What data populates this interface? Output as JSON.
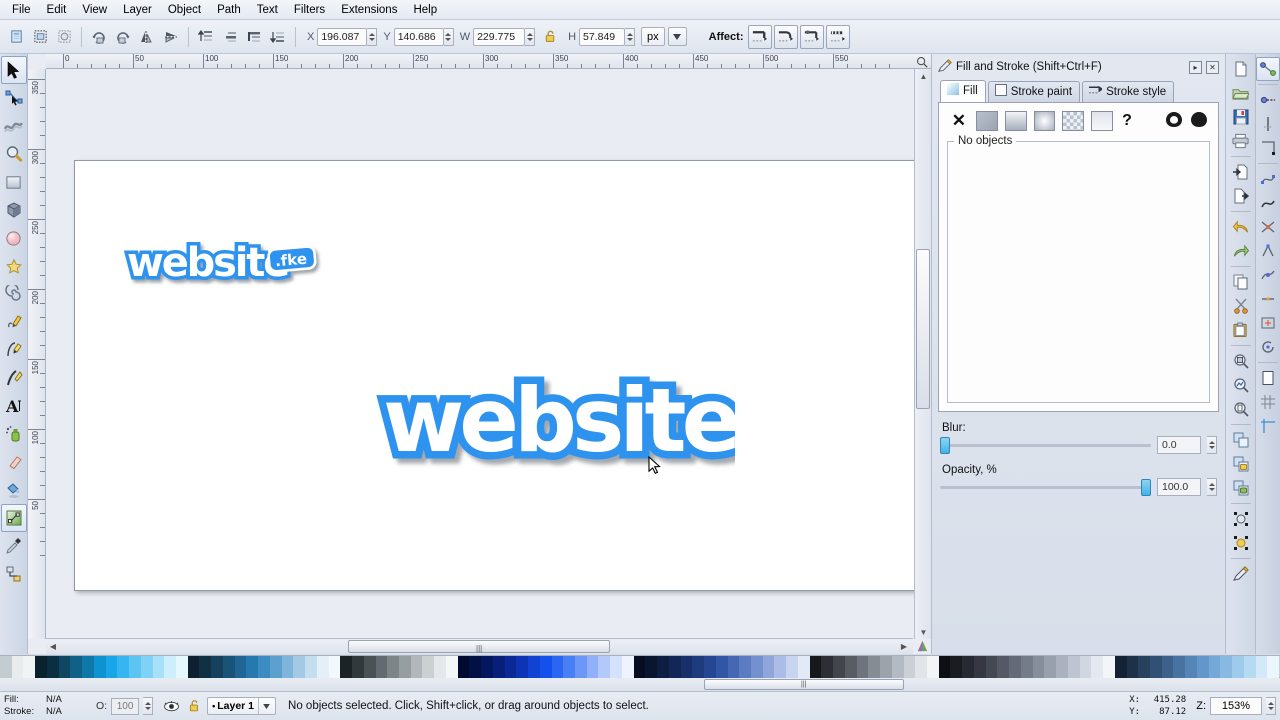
{
  "app": {
    "title": "Inkscape"
  },
  "menubar": {
    "items": [
      {
        "label": "File"
      },
      {
        "label": "Edit"
      },
      {
        "label": "View"
      },
      {
        "label": "Layer"
      },
      {
        "label": "Object"
      },
      {
        "label": "Path"
      },
      {
        "label": "Text"
      },
      {
        "label": "Filters"
      },
      {
        "label": "Extensions"
      },
      {
        "label": "Help"
      }
    ]
  },
  "commandbar": {
    "buttons": [
      {
        "name": "select-all-icon"
      },
      {
        "name": "select-all-in-all-layers-icon"
      },
      {
        "name": "deselect-icon"
      },
      {
        "name": "rotate-90-ccw-icon"
      },
      {
        "name": "rotate-90-cw-icon"
      },
      {
        "name": "flip-horizontal-icon"
      },
      {
        "name": "flip-vertical-icon"
      },
      {
        "name": "raise-to-top-icon"
      },
      {
        "name": "raise-icon"
      },
      {
        "name": "lower-icon"
      },
      {
        "name": "lower-to-bottom-icon"
      }
    ],
    "x_label": "X",
    "x_value": "196.087",
    "y_label": "Y",
    "y_value": "140.686",
    "w_label": "W",
    "w_value": "229.775",
    "h_label": "H",
    "h_value": "57.849",
    "lock_state": "unlocked",
    "unit_value": "px",
    "affect_label": "Affect:"
  },
  "toolbox": {
    "tools": [
      {
        "name": "selector-tool",
        "label": "Selector",
        "active": true
      },
      {
        "name": "node-tool",
        "label": "Node editor",
        "active": false
      },
      {
        "name": "tweak-tool",
        "label": "Tweak",
        "active": false
      },
      {
        "name": "zoom-tool",
        "label": "Zoom",
        "active": false
      },
      {
        "name": "rectangle-tool",
        "label": "Rectangle",
        "active": false
      },
      {
        "name": "3dbox-tool",
        "label": "3D Box",
        "active": false
      },
      {
        "name": "ellipse-tool",
        "label": "Ellipse",
        "active": false
      },
      {
        "name": "star-tool",
        "label": "Star",
        "active": false
      },
      {
        "name": "spiral-tool",
        "label": "Spiral",
        "active": false
      },
      {
        "name": "pencil-tool",
        "label": "Pencil",
        "active": false
      },
      {
        "name": "bezier-tool",
        "label": "Bezier/Pen",
        "active": false
      },
      {
        "name": "calligraphy-tool",
        "label": "Calligraphy",
        "active": false
      },
      {
        "name": "text-tool",
        "label": "Text",
        "active": false
      },
      {
        "name": "spray-tool",
        "label": "Spray",
        "active": false
      },
      {
        "name": "eraser-tool",
        "label": "Eraser",
        "active": false
      },
      {
        "name": "bucket-fill-tool",
        "label": "Bucket fill",
        "active": false
      },
      {
        "name": "gradient-tool",
        "label": "Gradient",
        "active": true
      },
      {
        "name": "dropper-tool",
        "label": "Dropper",
        "active": false
      },
      {
        "name": "connector-tool",
        "label": "Connector",
        "active": false
      }
    ]
  },
  "canvas": {
    "hruler_ticks": [
      "0",
      "50",
      "100",
      "150",
      "200",
      "250",
      "300",
      "350",
      "400",
      "450",
      "500",
      "550"
    ],
    "vruler_ticks": [
      "350",
      "300",
      "250",
      "200",
      "150",
      "100",
      "50"
    ],
    "artwork": [
      {
        "name": "logo-website-small",
        "text": "website",
        "badge": ".fke"
      },
      {
        "name": "logo-website-large",
        "text": "website",
        "badge": ""
      }
    ]
  },
  "dock": {
    "title": "Fill and Stroke (Shift+Ctrl+F)",
    "dock_buttons": [
      {
        "name": "dialog-menu-button",
        "glyph": "▸"
      },
      {
        "name": "dialog-close-button",
        "glyph": "✕"
      }
    ],
    "tabs": [
      {
        "name": "tab-fill",
        "label": "Fill",
        "active": true
      },
      {
        "name": "tab-stroke-paint",
        "label": "Stroke paint",
        "active": false
      },
      {
        "name": "tab-stroke-style",
        "label": "Stroke style",
        "active": false
      }
    ],
    "fill_types": [
      {
        "name": "fill-none-button",
        "kind": "none"
      },
      {
        "name": "fill-flat-color-button",
        "kind": "flat"
      },
      {
        "name": "fill-linear-gradient-button",
        "kind": "linear"
      },
      {
        "name": "fill-radial-gradient-button",
        "kind": "radial"
      },
      {
        "name": "fill-pattern-button",
        "kind": "pattern"
      },
      {
        "name": "fill-swatch-button",
        "kind": "swatch"
      },
      {
        "name": "fill-unknown-button",
        "kind": "unknown"
      },
      {
        "name": "fill-rule-nonzero-button",
        "kind": "evenodd"
      },
      {
        "name": "fill-rule-evenodd-button",
        "kind": "nonzero"
      }
    ],
    "no_objects_label": "No objects",
    "blur_label": "Blur:",
    "blur_value": "0.0",
    "blur_percent": 0,
    "opacity_label": "Opacity, %",
    "opacity_value": "100.0",
    "opacity_percent": 100
  },
  "right_commandbar": {
    "icons": [
      {
        "name": "new-document-icon"
      },
      {
        "name": "open-document-icon"
      },
      {
        "name": "save-document-icon"
      },
      {
        "name": "print-document-icon"
      },
      {
        "name": "import-icon"
      },
      {
        "name": "export-icon"
      },
      {
        "name": "undo-icon"
      },
      {
        "name": "redo-icon"
      },
      {
        "name": "copy-icon"
      },
      {
        "name": "cut-icon"
      },
      {
        "name": "paste-icon"
      },
      {
        "name": "duplicate-icon"
      },
      {
        "name": "zoom-selection-icon"
      },
      {
        "name": "zoom-drawing-icon"
      },
      {
        "name": "zoom-page-icon"
      },
      {
        "name": "group-icon"
      },
      {
        "name": "ungroup-icon"
      },
      {
        "name": "object-properties-icon"
      },
      {
        "name": "xml-editor-icon"
      },
      {
        "name": "align-icon"
      },
      {
        "name": "fill-stroke-icon"
      }
    ]
  },
  "snapbar": {
    "icons": [
      {
        "name": "snap-enable-icon",
        "active": true
      },
      {
        "name": "snap-bounding-box-icon"
      },
      {
        "name": "snap-bbox-edge-icon"
      },
      {
        "name": "snap-bbox-corner-icon"
      },
      {
        "name": "snap-nodes-icon"
      },
      {
        "name": "snap-path-icon"
      },
      {
        "name": "snap-path-intersection-icon"
      },
      {
        "name": "snap-cusp-node-icon"
      },
      {
        "name": "snap-smooth-node-icon"
      },
      {
        "name": "snap-midpoint-icon"
      },
      {
        "name": "snap-center-icon"
      },
      {
        "name": "snap-object-rotation-icon"
      },
      {
        "name": "snap-page-border-icon"
      },
      {
        "name": "snap-grid-icon"
      },
      {
        "name": "snap-guide-icon"
      }
    ]
  },
  "palette": {
    "colors": [
      "#c3ccd0",
      "#e8eced",
      "#f1f4f4",
      "#0a222e",
      "#0b2f42",
      "#0f4763",
      "#106087",
      "#0f78ab",
      "#0e93d1",
      "#19a6e8",
      "#35b6f0",
      "#5cc4f3",
      "#7fd1f6",
      "#a7e0f9",
      "#cdeefc",
      "#e6f7fe",
      "#0d2030",
      "#123044",
      "#17405c",
      "#1a5378",
      "#1f6694",
      "#2679ae",
      "#3b8cc0",
      "#5ba0ce",
      "#7fb5da",
      "#a3c9e5",
      "#c5deef",
      "#e4f0f8",
      "#f2f8fc",
      "#1b2326",
      "#32393d",
      "#4a5256",
      "#636b70",
      "#7d8589",
      "#979ea2",
      "#b1b7bb",
      "#cbd0d3",
      "#e4e8ea",
      "#f4f6f7",
      "#000a30",
      "#021046",
      "#04175e",
      "#071f7a",
      "#0a2896",
      "#0d34b4",
      "#1042d3",
      "#1451ec",
      "#2a66f2",
      "#4a7ef5",
      "#6d97f7",
      "#90b0f9",
      "#b3c9fb",
      "#d5e2fd",
      "#eef3fe",
      "#060d20",
      "#0a1530",
      "#0e1d42",
      "#132655",
      "#183069",
      "#1e3b7e",
      "#254793",
      "#3256a6",
      "#4567b4",
      "#5b7bc2",
      "#7490cf",
      "#8fa6db",
      "#abbde6",
      "#c8d4ef",
      "#e3eaf7",
      "#16181c",
      "#2c2f34",
      "#42464c",
      "#585d64",
      "#6f747c",
      "#868c94",
      "#9da3ab",
      "#b4bac1",
      "#cbd0d6",
      "#e1e5e9",
      "#f2f4f6",
      "#0e0f14",
      "#1a1c22",
      "#272a32",
      "#353842",
      "#444853",
      "#545965",
      "#646a77",
      "#757c89",
      "#878e9b",
      "#99a0ad",
      "#abb2bf",
      "#bec5d1",
      "#d1d7e1",
      "#e4e9f0",
      "#f3f6f9",
      "#142233",
      "#1d3148",
      "#27405e",
      "#315074",
      "#3c618a",
      "#4872a0",
      "#5584b6",
      "#6396c9",
      "#74a8d8",
      "#87b9e3",
      "#9ecaec",
      "#b7daf3",
      "#d2e9f9",
      "#ecf6fd"
    ]
  },
  "statusbar": {
    "fill_label": "Fill:",
    "fill_value": "N/A",
    "stroke_label": "Stroke:",
    "stroke_value": "N/A",
    "opacity_label": "O:",
    "opacity_value": "100",
    "layer_visibility_icon": "eye-icon",
    "layer_lock_icon": "unlock-icon",
    "layer_name": "Layer 1",
    "message": "No objects selected. Click, Shift+click, or drag around objects to select.",
    "x_label": "X:",
    "x_value": "415.28",
    "y_label": "Y:",
    "y_value": "87.12",
    "zoom_label": "Z:",
    "zoom_value": "153%"
  }
}
